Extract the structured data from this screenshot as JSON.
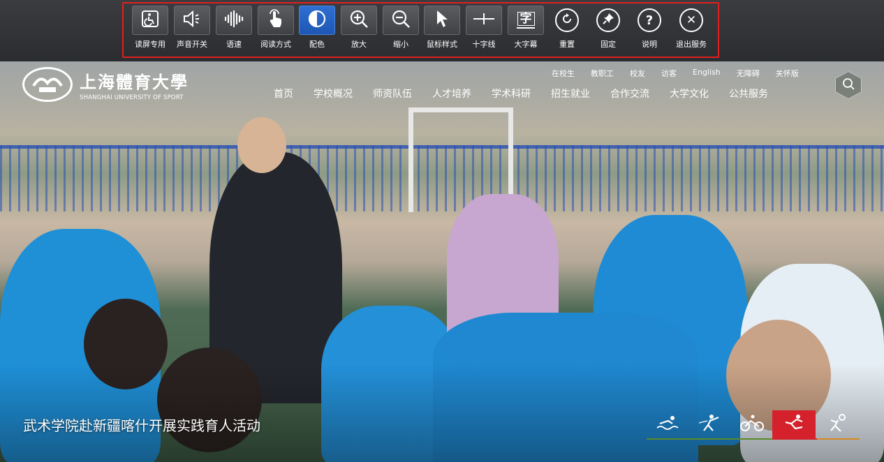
{
  "toolbar": {
    "tools": [
      {
        "label": "读屏专用",
        "icon": "wheelchair-icon"
      },
      {
        "label": "声音开关",
        "icon": "speaker-icon"
      },
      {
        "label": "语速",
        "icon": "waveform-icon"
      },
      {
        "label": "阅读方式",
        "icon": "pointer-hand-icon"
      },
      {
        "label": "配色",
        "icon": "contrast-icon",
        "active": true
      },
      {
        "label": "放大",
        "icon": "zoom-in-icon"
      },
      {
        "label": "缩小",
        "icon": "zoom-out-icon"
      },
      {
        "label": "鼠标样式",
        "icon": "cursor-icon"
      },
      {
        "label": "十字线",
        "icon": "crosshair-icon"
      },
      {
        "label": "大字幕",
        "icon": "large-caption-icon",
        "glyph": "字"
      },
      {
        "label": "重置",
        "icon": "reset-icon"
      },
      {
        "label": "固定",
        "icon": "pin-icon"
      },
      {
        "label": "说明",
        "icon": "help-icon",
        "glyph": "?"
      },
      {
        "label": "退出服务",
        "icon": "close-icon",
        "glyph": "✕"
      }
    ],
    "frame_color": "#e02020",
    "active_color": "#2f6fd0"
  },
  "site": {
    "logo_cn": "上海體育大學",
    "logo_en": "SHANGHAI UNIVERSITY OF SPORT",
    "top_links": [
      "在校生",
      "教职工",
      "校友",
      "访客",
      "English",
      "无障碍",
      "关怀版"
    ],
    "nav": [
      "首页",
      "学校概况",
      "师资队伍",
      "人才培养",
      "学术科研",
      "招生就业",
      "合作交流",
      "大学文化",
      "公共服务"
    ],
    "headline": "武术学院赴新疆喀什开展实践育人活动",
    "sport_icons": [
      "swimming-icon",
      "fencing-icon",
      "cycling-icon",
      "martial-arts-icon",
      "ball-sport-icon"
    ],
    "active_sport_index": 3,
    "accent_red": "#d4212b"
  }
}
